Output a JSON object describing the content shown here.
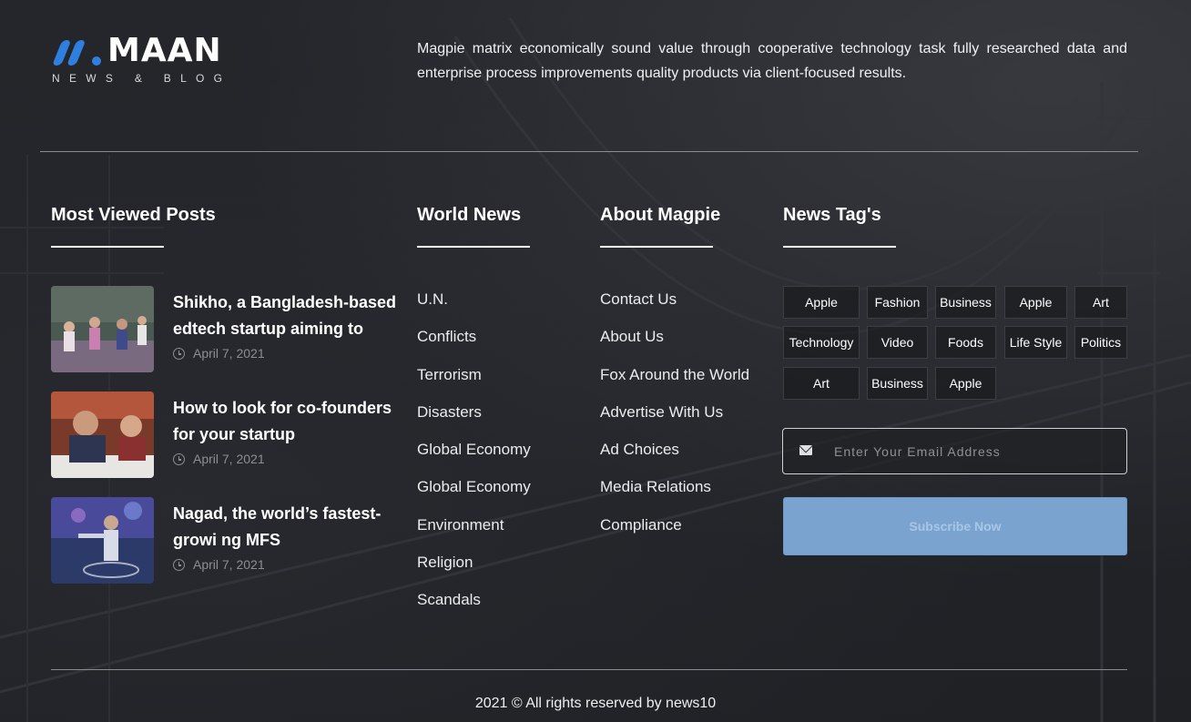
{
  "brand": {
    "name": "MAAN",
    "tagline": "NEWS & BLOG",
    "accent_color": "#2f7fe0"
  },
  "intro_text": "Magpie matrix economically sound value through cooperative technology task fully researched data and enterprise process improvements quality products via client-focused results.",
  "most_viewed": {
    "title": "Most Viewed Posts",
    "posts": [
      {
        "title": "Shikho, a Bangladesh-based edtech startup aiming to",
        "date": "April 7, 2021",
        "icon": "clock-icon"
      },
      {
        "title": "How to look for co-founders for your startup",
        "date": "April 7, 2021",
        "icon": "clock-icon"
      },
      {
        "title": "Nagad, the world’s fastest-growi ng MFS",
        "date": "April 7, 2021",
        "icon": "clock-icon"
      }
    ]
  },
  "world_news": {
    "title": "World News",
    "links": [
      "U.N.",
      "Conflicts",
      "Terrorism",
      "Disasters",
      "Global Economy",
      "Global Economy",
      "Environment",
      "Religion",
      "Scandals"
    ]
  },
  "about": {
    "title": "About Magpie",
    "links": [
      "Contact Us",
      "About Us",
      "Fox Around the World",
      "Advertise With Us",
      "Ad Choices",
      "Media Relations",
      "Compliance"
    ]
  },
  "tags": {
    "title": "News Tag's",
    "items": [
      "Apple",
      "Fashion",
      "Business",
      "Apple",
      "Art",
      "Technology",
      "Video",
      "Foods",
      "Life Style",
      "Politics",
      "Art",
      "Business",
      "Apple"
    ]
  },
  "newsletter": {
    "placeholder": "Enter Your Email Address",
    "button_label": "Subscribe Now",
    "icon": "envelope-icon",
    "button_color": "#7aa3d0"
  },
  "copyright": "2021 © All rights reserved by news10"
}
